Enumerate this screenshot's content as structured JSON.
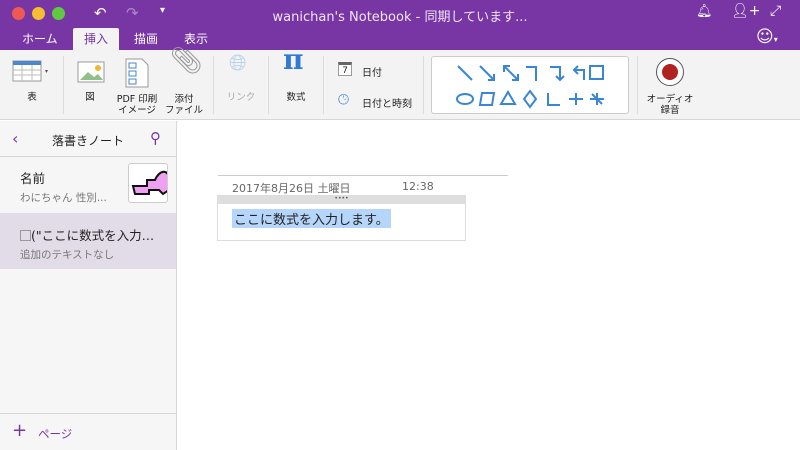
{
  "window": {
    "title": "wanichan's Notebook - 同期しています...",
    "accent": "#7836a5"
  },
  "tabs": [
    {
      "label": "ホーム"
    },
    {
      "label": "挿入",
      "active": true
    },
    {
      "label": "描画"
    },
    {
      "label": "表示"
    }
  ],
  "ribbon": {
    "table": "表",
    "picture": "図",
    "pdf": "PDF 印刷",
    "pdf2": "イメージ",
    "attach": "添付",
    "attach2": "ファイル",
    "link": "リンク",
    "equation": "数式",
    "date": "日付",
    "date_icon_num": "7",
    "datetime": "日付と時刻",
    "audio": "オーディオ",
    "audio2": "録音"
  },
  "sidebar": {
    "title": "落書きノート",
    "pages": [
      {
        "title": "名前",
        "preview": "わにちゃん  性別..."
      },
      {
        "title": "(\"ここに数式を入力…",
        "preview": "追加のテキストなし",
        "selected": true
      }
    ],
    "add_page": "ページ"
  },
  "note": {
    "date": "2017年8月26日 土曜日",
    "time": "12:38",
    "content": "ここに数式を入力します。"
  }
}
